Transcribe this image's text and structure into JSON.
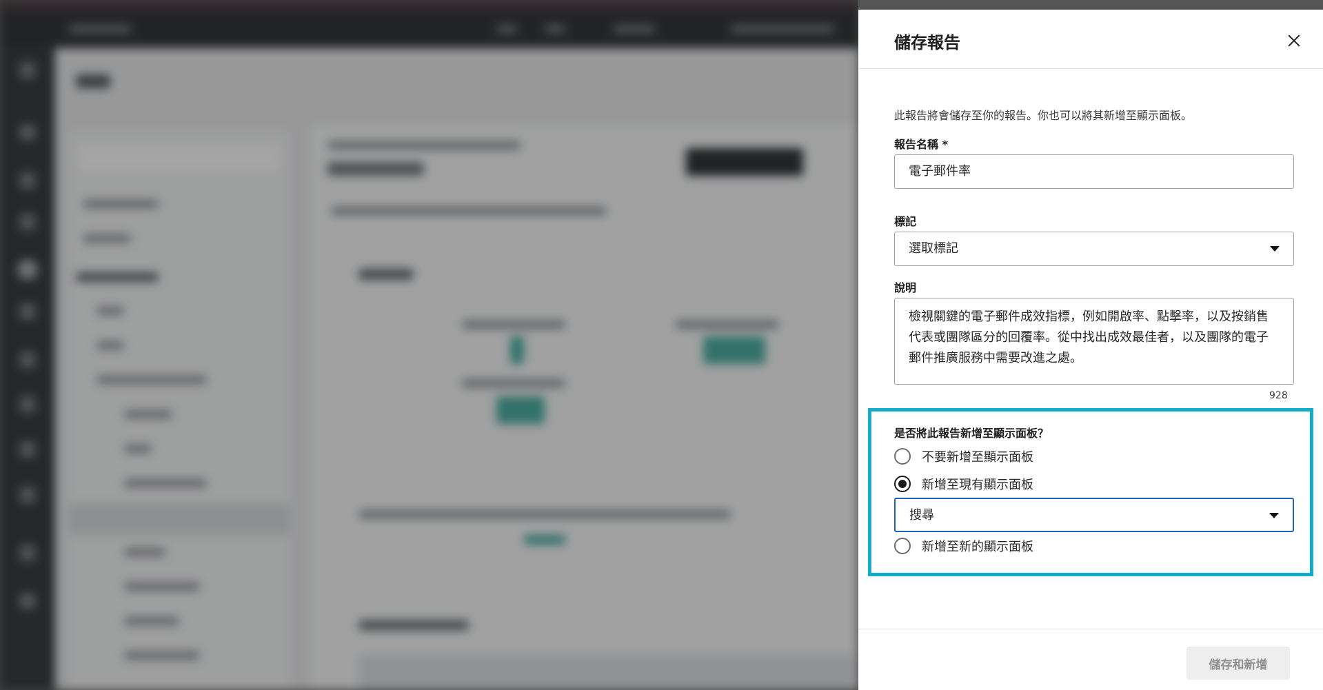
{
  "panel": {
    "title": "儲存報告",
    "intro": "此報告將會儲存至你的報告。你也可以將其新增至顯示面板。",
    "report_name": {
      "label": "報告名稱 *",
      "value": "電子郵件率"
    },
    "tag": {
      "label": "標記",
      "placeholder": "選取標記"
    },
    "description": {
      "label": "說明",
      "value": "檢視關鍵的電子郵件成效指標，例如開啟率、點擊率，以及按銷售代表或團隊區分的回覆率。從中找出成效最佳者，以及團隊的電子郵件推廣服務中需要改進之處。",
      "counter": "928"
    },
    "dashboard": {
      "question": "是否將此報告新增至顯示面板？",
      "options": [
        {
          "label": "不要新增至顯示面板",
          "checked": false
        },
        {
          "label": "新增至現有顯示面板",
          "checked": true
        },
        {
          "label": "新增至新的顯示面板",
          "checked": false
        }
      ],
      "search_placeholder": "搜尋"
    },
    "save_button": "儲存和新增"
  },
  "colors": {
    "highlight": "#14adc7",
    "focus_border": "#1e63b5",
    "background_teal": "#3aa79a"
  }
}
